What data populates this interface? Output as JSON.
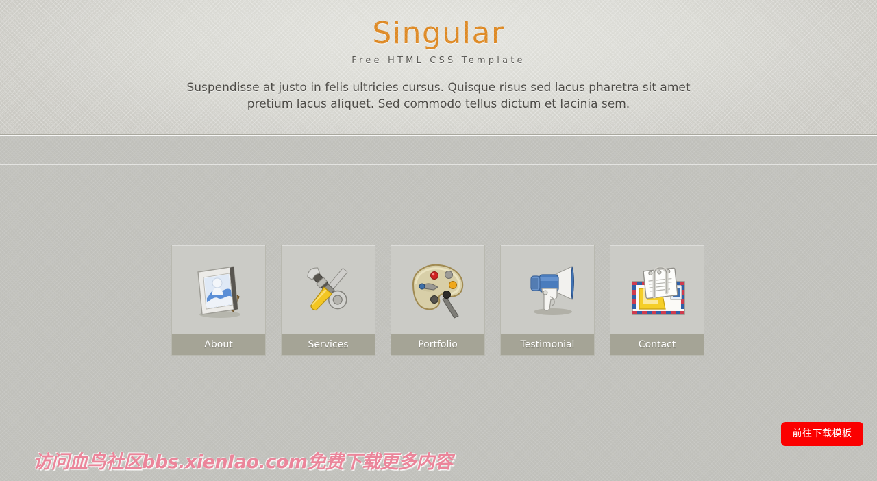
{
  "header": {
    "title": "Singular",
    "subtitle": "Free HTML CSS Template",
    "intro": "Suspendisse at justo in felis ultricies cursus. Quisque risus sed lacus pharetra sit amet pretium lacus aliquet. Sed commodo tellus dictum et lacinia sem.",
    "title_color": "#dd8822",
    "subtitle_color": "#55544f"
  },
  "main": {
    "boxes": [
      {
        "label": "About",
        "icon": "picture-frame-icon"
      },
      {
        "label": "Services",
        "icon": "wrench-screwdriver-icon"
      },
      {
        "label": "Portfolio",
        "icon": "paint-palette-icon"
      },
      {
        "label": "Testimonial",
        "icon": "megaphone-icon"
      },
      {
        "label": "Contact",
        "icon": "envelope-mail-icon"
      }
    ],
    "box_background": "#cbcbc6",
    "label_background": "#a5a496"
  },
  "overlay": {
    "download_button_label": "前往下载模板",
    "download_button_color": "#fb0000",
    "watermark_text": "访问血鸟社区bbs.xienIao.com免费下载更多内容",
    "watermark_color": "#ef8198"
  },
  "page": {
    "background_color": "#c0c0bb"
  }
}
